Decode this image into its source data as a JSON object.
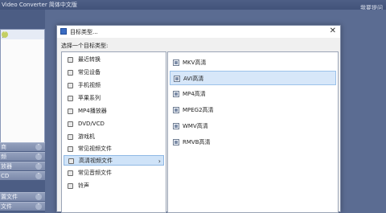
{
  "app": {
    "title": "Video Converter 简体中文版",
    "help_link": "我要提问",
    "sidebar_groups": [
      "商",
      "频",
      "放器",
      "CD",
      "置文件",
      "文件"
    ]
  },
  "dialog": {
    "title": "目标类型...",
    "prompt": "选择一个目标类型:",
    "close_glyph": "✕",
    "categories": [
      {
        "label": "最近转换",
        "selected": false
      },
      {
        "label": "常见设备",
        "selected": false
      },
      {
        "label": "手机视频",
        "selected": false
      },
      {
        "label": "苹果系列",
        "selected": false
      },
      {
        "label": "MP4播放器",
        "selected": false
      },
      {
        "label": "DVD/VCD",
        "selected": false
      },
      {
        "label": "游戏机",
        "selected": false
      },
      {
        "label": "常见视频文件",
        "selected": false
      },
      {
        "label": "高清视频文件",
        "selected": true
      },
      {
        "label": "常见音频文件",
        "selected": false
      },
      {
        "label": "铃声",
        "selected": false
      }
    ],
    "formats": [
      {
        "label": "MKV高清",
        "selected": false
      },
      {
        "label": "AVI高清",
        "selected": true
      },
      {
        "label": "MP4高清",
        "selected": false
      },
      {
        "label": "MPEG2高清",
        "selected": false
      },
      {
        "label": "WMV高清",
        "selected": false
      },
      {
        "label": "RMVB高清",
        "selected": false
      }
    ]
  },
  "colors": {
    "selection_bg": "#cfe3f8",
    "app_bg": "#5b6c92"
  }
}
